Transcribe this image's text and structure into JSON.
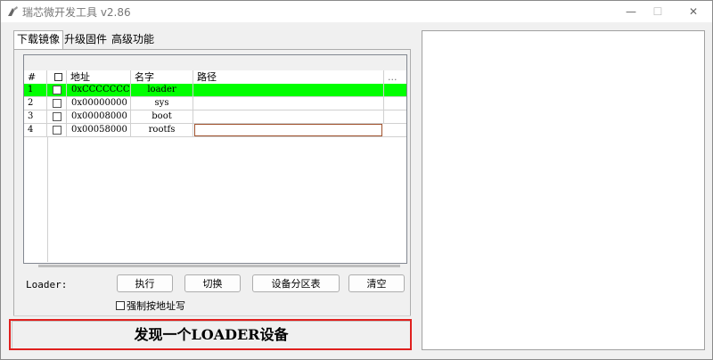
{
  "window": {
    "title": "瑞芯微开发工具 v2.86",
    "minimize": "—",
    "maximize": "☐",
    "close": "✕"
  },
  "tabs": [
    {
      "label": "下载镜像",
      "active": true
    },
    {
      "label": "升级固件",
      "active": false
    },
    {
      "label": "高级功能",
      "active": false
    }
  ],
  "table": {
    "headers": {
      "num": "#",
      "address": "地址",
      "name": "名字",
      "path": "路径",
      "more": "..."
    },
    "rows": [
      {
        "num": "1",
        "address": "0xCCCCCCCC",
        "name": "loader",
        "path": "",
        "selected": true
      },
      {
        "num": "2",
        "address": "0x00000000",
        "name": "sys",
        "path": "",
        "selected": false
      },
      {
        "num": "3",
        "address": "0x00008000",
        "name": "boot",
        "path": "",
        "selected": false
      },
      {
        "num": "4",
        "address": "0x00058000",
        "name": "rootfs",
        "path": "",
        "selected": false
      }
    ],
    "selected_color": "#00ff00"
  },
  "controls": {
    "loader_label": "Loader:",
    "run": "执行",
    "switch": "切换",
    "partition_table": "设备分区表",
    "clear": "清空",
    "force_by_address": "强制按地址写"
  },
  "status": {
    "text": "发现一个LOADER设备",
    "highlight_color": "#e0201e"
  }
}
